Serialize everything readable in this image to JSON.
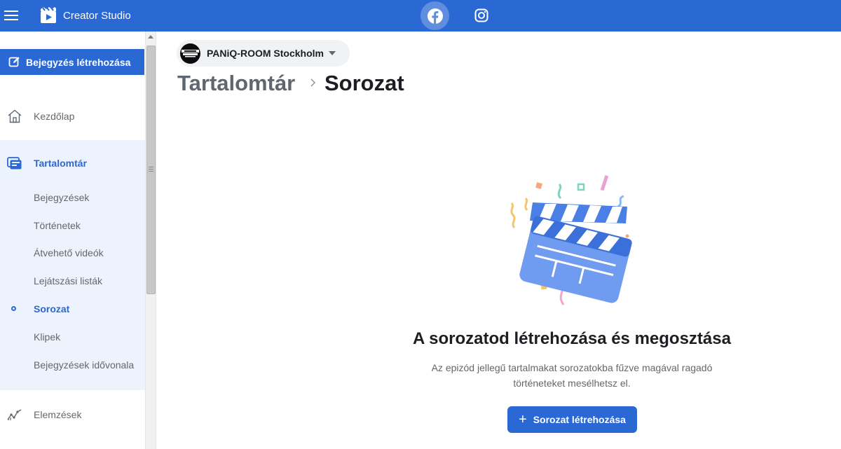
{
  "app": {
    "title": "Creator Studio"
  },
  "topbar": {
    "platform_tabs": [
      "facebook",
      "instagram"
    ]
  },
  "sidebar": {
    "create_post_label": "Bejegyzés létrehozása",
    "home_label": "Kezdőlap",
    "content_library_label": "Tartalomtár",
    "sub_items": [
      {
        "label": "Bejegyzések"
      },
      {
        "label": "Történetek"
      },
      {
        "label": "Átvehető videók"
      },
      {
        "label": "Lejátszási listák"
      },
      {
        "label": "Sorozat",
        "active": true
      },
      {
        "label": "Klipek"
      },
      {
        "label": "Bejegyzések idővonala"
      }
    ],
    "analytics_label": "Elemzések"
  },
  "page_switcher": {
    "page_name": "PANiQ-ROOM Stockholm"
  },
  "breadcrumb": {
    "root": "Tartalomtár",
    "current": "Sorozat"
  },
  "empty_state": {
    "title": "A sorozatod létrehozása és megosztása",
    "description": "Az epizód jellegű tartalmakat sorozatokba fűzve magával ragadó történeteket mesélhetsz el.",
    "button_label": "Sorozat létrehozása",
    "button_icon": "+"
  },
  "colors": {
    "brand_blue": "#2a68d4",
    "sidebar_group_bg": "#edf3fc",
    "clapper_blue": "#4a7fe5"
  }
}
